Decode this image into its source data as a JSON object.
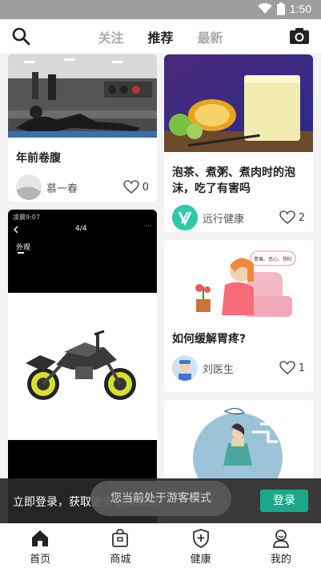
{
  "status": {
    "time": "1:50",
    "icons": [
      "wifi-icon",
      "battery-icon"
    ]
  },
  "top": {
    "tabs": [
      {
        "label": "关注",
        "active": false
      },
      {
        "label": "推荐",
        "active": true
      },
      {
        "label": "最新",
        "active": false
      }
    ]
  },
  "feed": {
    "cards": [
      {
        "title": "年前卷腹",
        "author": "慕一春",
        "likes": "0"
      },
      {
        "title": "泡茶、煮粥、煮肉时的泡沫，吃了有害吗",
        "author": "远行健康",
        "likes": "2"
      },
      {
        "title": "如何缓解胃疼?",
        "author": "刘医生",
        "likes": "1"
      }
    ],
    "screenshot_card": {
      "status_text": "凌晨9:07",
      "page_indicator": "4/4",
      "tag": "外观"
    },
    "illustration_text": "胃痛、恶心、想吐"
  },
  "guest": {
    "text": "立即登录，获取更多健康资讯",
    "login_label": "登录",
    "toast": "您当前处于游客模式"
  },
  "nav": {
    "items": [
      {
        "label": "首页",
        "icon": "home-icon"
      },
      {
        "label": "商城",
        "icon": "shopping-bag-icon"
      },
      {
        "label": "健康",
        "icon": "health-shield-icon"
      },
      {
        "label": "我的",
        "icon": "profile-icon"
      }
    ]
  }
}
